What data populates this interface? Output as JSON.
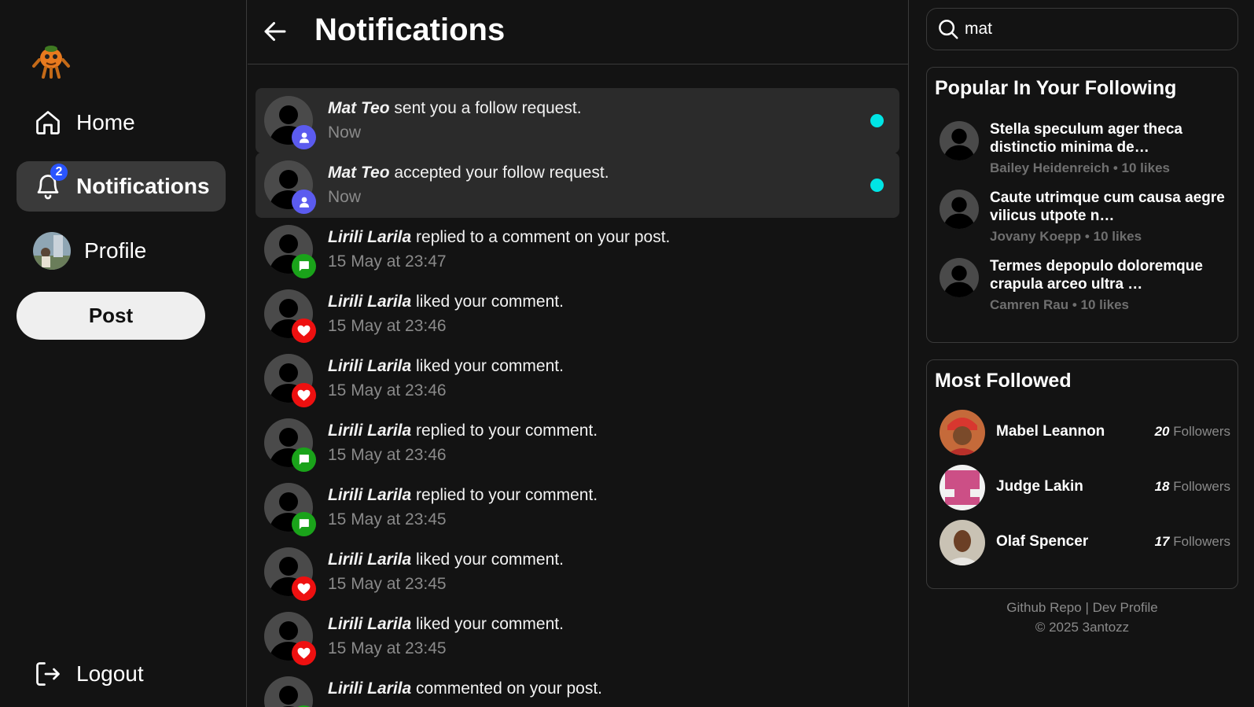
{
  "sidebar": {
    "home_label": "Home",
    "notifications_label": "Notifications",
    "notifications_badge": "2",
    "profile_label": "Profile",
    "post_label": "Post",
    "logout_label": "Logout"
  },
  "header": {
    "title": "Notifications"
  },
  "notifications": [
    {
      "user": "Mat Teo",
      "action": " sent you a follow request.",
      "time": "Now",
      "type": "follow",
      "unread": true
    },
    {
      "user": "Mat Teo",
      "action": " accepted your follow request.",
      "time": "Now",
      "type": "follow",
      "unread": true
    },
    {
      "user": "Lirili Larila",
      "action": " replied to a comment on your post.",
      "time": "15 May at 23:47",
      "type": "reply",
      "unread": false
    },
    {
      "user": "Lirili Larila",
      "action": " liked your comment.",
      "time": "15 May at 23:46",
      "type": "like",
      "unread": false
    },
    {
      "user": "Lirili Larila",
      "action": " liked your comment.",
      "time": "15 May at 23:46",
      "type": "like",
      "unread": false
    },
    {
      "user": "Lirili Larila",
      "action": " replied to your comment.",
      "time": "15 May at 23:46",
      "type": "reply",
      "unread": false
    },
    {
      "user": "Lirili Larila",
      "action": " replied to your comment.",
      "time": "15 May at 23:45",
      "type": "reply",
      "unread": false
    },
    {
      "user": "Lirili Larila",
      "action": " liked your comment.",
      "time": "15 May at 23:45",
      "type": "like",
      "unread": false
    },
    {
      "user": "Lirili Larila",
      "action": " liked your comment.",
      "time": "15 May at 23:45",
      "type": "like",
      "unread": false
    },
    {
      "user": "Lirili Larila",
      "action": " commented on your post.",
      "time": "",
      "type": "reply",
      "unread": false
    }
  ],
  "search": {
    "value": "mat"
  },
  "popular": {
    "title": "Popular In Your Following",
    "items": [
      {
        "title": "Stella speculum ager theca distinctio minima de…",
        "author": "Bailey Heidenreich",
        "likes": "10 likes"
      },
      {
        "title": "Caute utrimque cum causa aegre vilicus utpote n…",
        "author": "Jovany Koepp",
        "likes": "10 likes"
      },
      {
        "title": "Termes depopulo doloremque crapula arceo ultra …",
        "author": "Camren Rau",
        "likes": "10 likes"
      }
    ]
  },
  "most_followed": {
    "title": "Most Followed",
    "followers_word": "Followers",
    "items": [
      {
        "name": "Mabel Leannon",
        "count": "20"
      },
      {
        "name": "Judge Lakin",
        "count": "18"
      },
      {
        "name": "Olaf Spencer",
        "count": "17"
      }
    ]
  },
  "footer": {
    "links": "Github Repo | Dev Profile",
    "copyright": "© 2025 3antozz"
  },
  "colors": {
    "background": "#131313",
    "unread_dot": "#00e5e5",
    "badge": "#2a55ff",
    "follow_icon": "#5b5bef",
    "reply_icon": "#1aa31a",
    "like_icon": "#ee1010"
  }
}
